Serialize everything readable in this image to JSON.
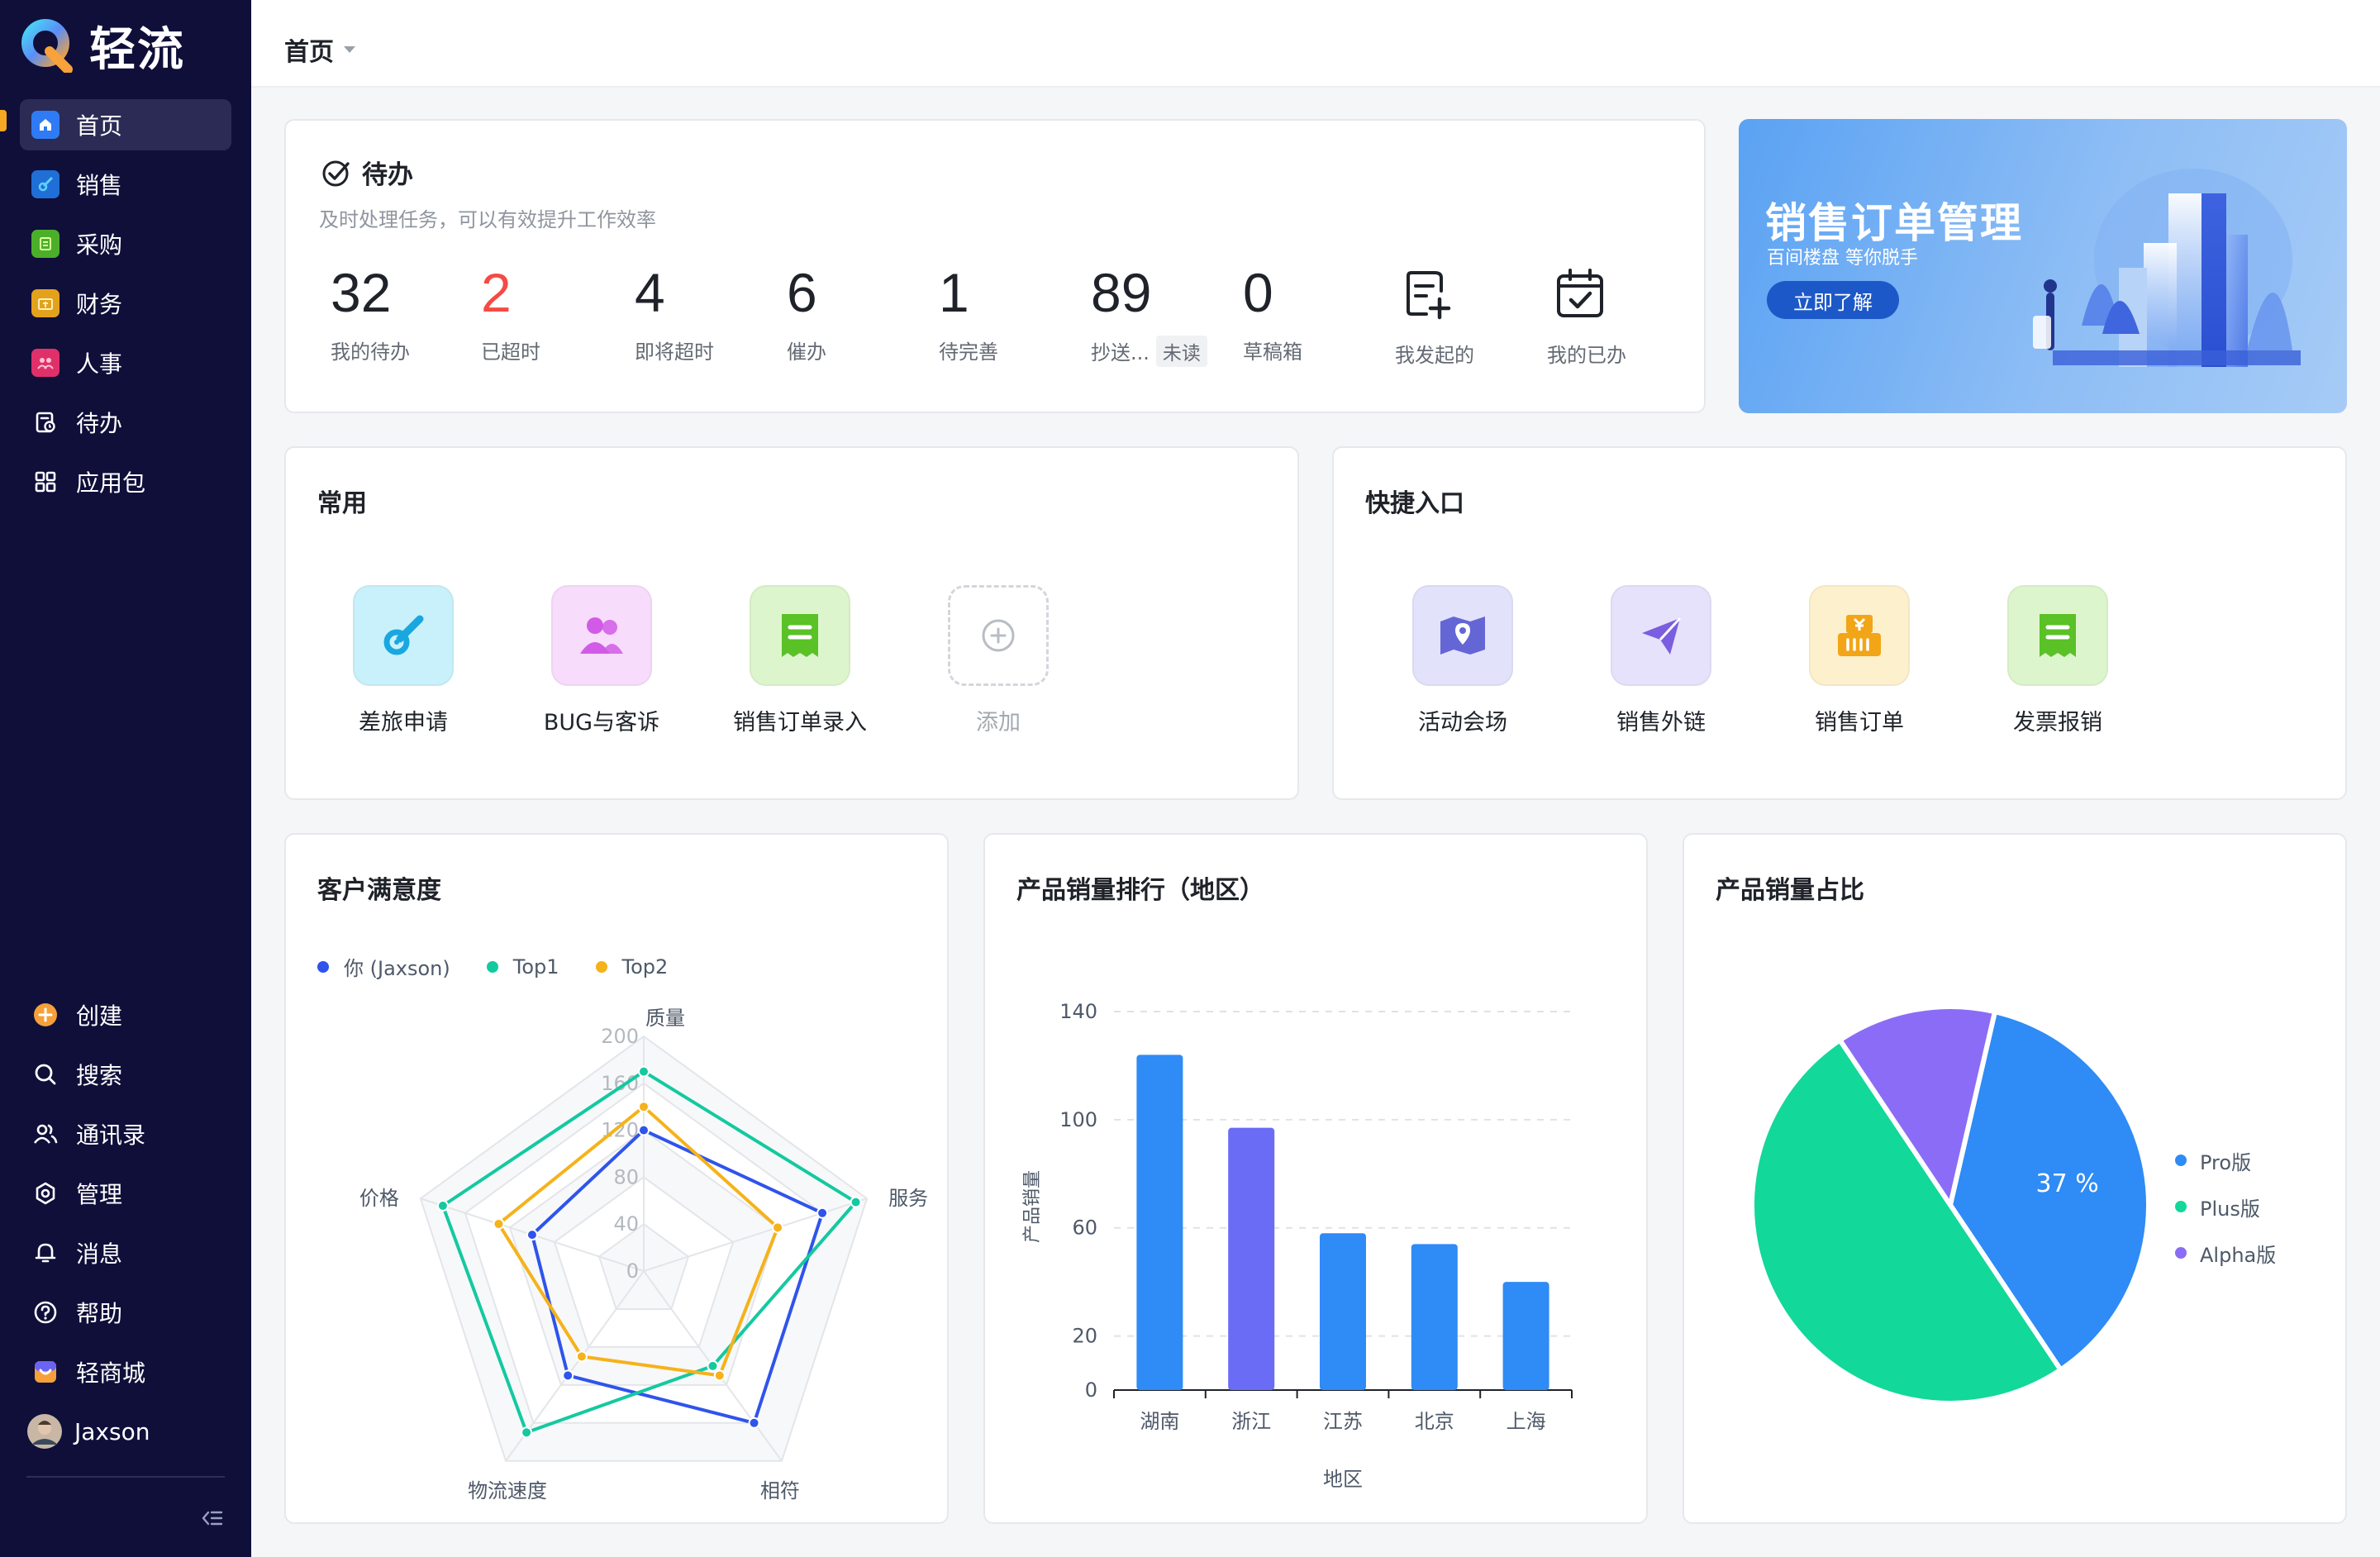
{
  "app": {
    "name": "轻流"
  },
  "sidebar": {
    "top_items": [
      {
        "label": "首页",
        "icon": "home-icon",
        "active": true
      },
      {
        "label": "销售",
        "icon": "sales-icon"
      },
      {
        "label": "采购",
        "icon": "purchase-icon"
      },
      {
        "label": "财务",
        "icon": "finance-icon"
      },
      {
        "label": "人事",
        "icon": "hr-icon"
      },
      {
        "label": "待办",
        "icon": "todo-icon"
      },
      {
        "label": "应用包",
        "icon": "app-package-icon"
      }
    ],
    "bottom_items": [
      {
        "label": "创建",
        "icon": "create-icon"
      },
      {
        "label": "搜索",
        "icon": "search-icon"
      },
      {
        "label": "通讯录",
        "icon": "contacts-icon"
      },
      {
        "label": "管理",
        "icon": "settings-icon"
      },
      {
        "label": "消息",
        "icon": "bell-icon"
      },
      {
        "label": "帮助",
        "icon": "help-icon"
      },
      {
        "label": "轻商城",
        "icon": "store-icon"
      },
      {
        "label": "Jaxson",
        "icon": "avatar"
      }
    ]
  },
  "header": {
    "title": "首页"
  },
  "todo": {
    "title": "待办",
    "subtitle": "及时处理任务，可以有效提升工作效率",
    "stats": [
      {
        "value": "32",
        "label": "我的待办"
      },
      {
        "value": "2",
        "label": "已超时"
      },
      {
        "value": "4",
        "label": "即将超时"
      },
      {
        "value": "6",
        "label": "催办"
      },
      {
        "value": "1",
        "label": "待完善"
      },
      {
        "value": "89",
        "label": "抄送...",
        "badge": "未读"
      },
      {
        "value": "0",
        "label": "草稿箱"
      }
    ],
    "shortcuts": [
      {
        "label": "我发起的",
        "icon": "initiated-icon"
      },
      {
        "label": "我的已办",
        "icon": "done-calendar-icon"
      }
    ]
  },
  "banner": {
    "title": "销售订单管理",
    "subtitle": "百间楼盘 等你脱手",
    "button": "立即了解"
  },
  "common": {
    "title": "常用",
    "apps": [
      {
        "label": "差旅申请",
        "icon": "travel-icon",
        "bg": "#c9f1fb",
        "color": "#1aa7e0"
      },
      {
        "label": "BUG与客诉",
        "icon": "people-icon",
        "bg": "#f7dcfb",
        "color": "#d15be6"
      },
      {
        "label": "销售订单录入",
        "icon": "receipt-icon",
        "bg": "#ddf5cc",
        "color": "#5ac126"
      },
      {
        "label": "添加",
        "icon": "add-icon"
      }
    ]
  },
  "quick": {
    "title": "快捷入口",
    "apps": [
      {
        "label": "活动会场",
        "icon": "map-pin-icon",
        "bg": "#e2e2fb",
        "color": "#6466d6"
      },
      {
        "label": "销售外链",
        "icon": "paper-plane-icon",
        "bg": "#e7e2fb",
        "color": "#7a5ee0"
      },
      {
        "label": "销售订单",
        "icon": "yen-register-icon",
        "bg": "#fdf0cc",
        "color": "#f2a516"
      },
      {
        "label": "发票报销",
        "icon": "invoice-icon",
        "bg": "#ddf5cc",
        "color": "#5ac126"
      }
    ]
  },
  "satisfaction": {
    "title": "客户满意度",
    "chart_data": {
      "type": "radar",
      "axes": [
        "质量",
        "服务",
        "相符",
        "物流速度",
        "价格"
      ],
      "ticks": [
        "200",
        "160",
        "120",
        "80",
        "40",
        "0"
      ],
      "max": 200,
      "series": [
        {
          "name": "你 (Jaxson)",
          "color": "#2f54eb",
          "values": [
            120,
            160,
            160,
            110,
            100
          ]
        },
        {
          "name": "Top1",
          "color": "#14c9a0",
          "values": [
            170,
            190,
            100,
            170,
            180
          ]
        },
        {
          "name": "Top2",
          "color": "#f5b21b",
          "values": [
            140,
            120,
            110,
            90,
            130
          ]
        }
      ]
    }
  },
  "ranking": {
    "title": "产品销量排行（地区）",
    "chart_data": {
      "type": "bar",
      "categories": [
        "湖南",
        "浙江",
        "江苏",
        "北京",
        "上海"
      ],
      "values": [
        124,
        97,
        58,
        54,
        40
      ],
      "colors": [
        "#2f8bf5",
        "#6a6cf6",
        "#2f8bf5",
        "#2f8bf5",
        "#2f8bf5"
      ],
      "yticks": [
        "140",
        "100",
        "60",
        "20",
        "0"
      ],
      "ylabel": "产品销量",
      "xlabel": "地区"
    }
  },
  "share": {
    "title": "产品销量占比",
    "chart_data": {
      "type": "pie",
      "series": [
        {
          "name": "Pro版",
          "value": 37,
          "color": "#2f8bf5",
          "label": "37 %"
        },
        {
          "name": "Plus版",
          "value": 50,
          "color": "#12d89a"
        },
        {
          "name": "Alpha版",
          "value": 13,
          "color": "#8b6cf6"
        }
      ]
    }
  }
}
